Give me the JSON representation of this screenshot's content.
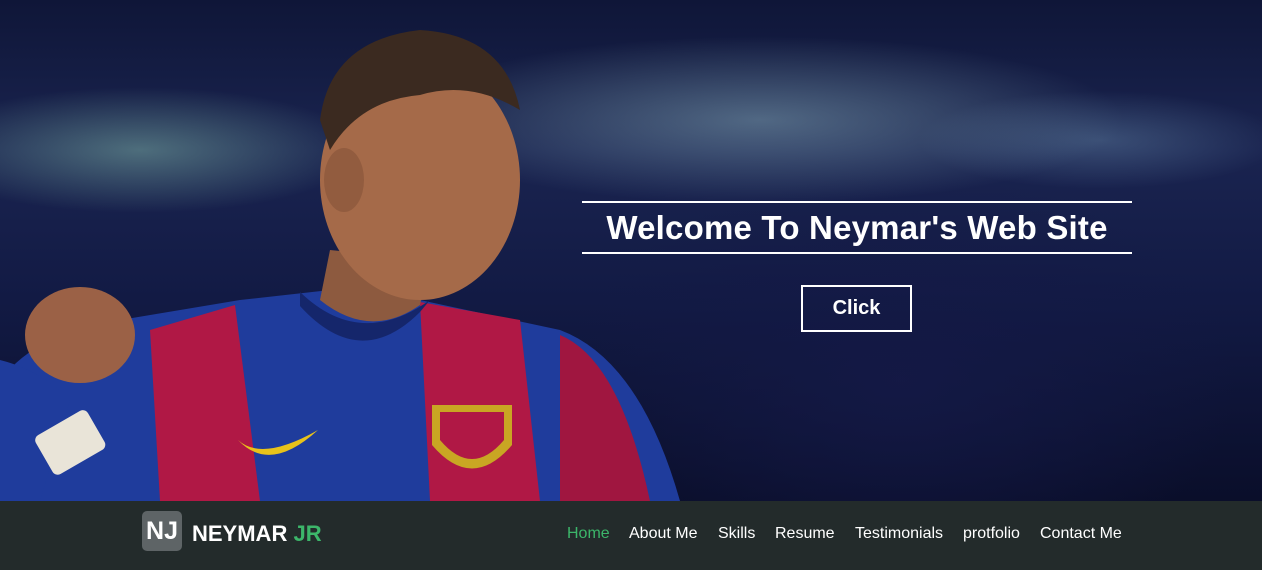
{
  "hero": {
    "headline": "Welcome To Neymar's Web Site",
    "cta_label": "Click"
  },
  "brand": {
    "logo_initials": "NJ",
    "name_main": "NEYMAR",
    "name_accent": "JR"
  },
  "nav": {
    "items": [
      {
        "label": "Home",
        "active": true
      },
      {
        "label": "About Me"
      },
      {
        "label": "Skills"
      },
      {
        "label": "Resume"
      },
      {
        "label": "Testimonials"
      },
      {
        "label": "protfolio"
      },
      {
        "label": "Contact Me"
      }
    ]
  },
  "colors": {
    "accent": "#3cb66a",
    "navbar_bg": "#232b2b",
    "logo_bg": "#5e6466",
    "jersey_blue": "#1f3c9c",
    "jersey_red": "#b01845"
  }
}
